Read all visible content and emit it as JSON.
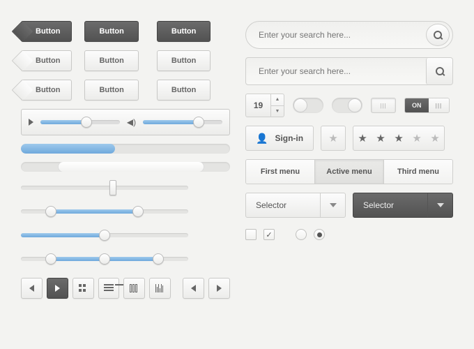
{
  "buttons": {
    "row1": [
      "Button",
      "Button",
      "Button"
    ],
    "row2": [
      "Button",
      "Button",
      "Button"
    ],
    "row3": [
      "Button",
      "Button",
      "Button"
    ]
  },
  "player": {
    "position": 58,
    "volume": 70
  },
  "progress": {
    "blue": 45,
    "light_start": 18,
    "light_end": 88
  },
  "sliders": {
    "a": 55,
    "b_handles": [
      18,
      70
    ],
    "c": 50,
    "d_handles": [
      18,
      50,
      82
    ]
  },
  "search": {
    "placeholder": "Enter your search here..."
  },
  "stepper": {
    "value": "19"
  },
  "toggle_on_label": "ON",
  "signin": "Sign-in",
  "stars": {
    "total": 5,
    "filled": 3
  },
  "menu": [
    "First menu",
    "Active menu",
    "Third menu"
  ],
  "menu_active": 1,
  "selector": "Selector",
  "checkboxes": [
    false,
    true
  ],
  "radios": [
    false,
    true
  ]
}
